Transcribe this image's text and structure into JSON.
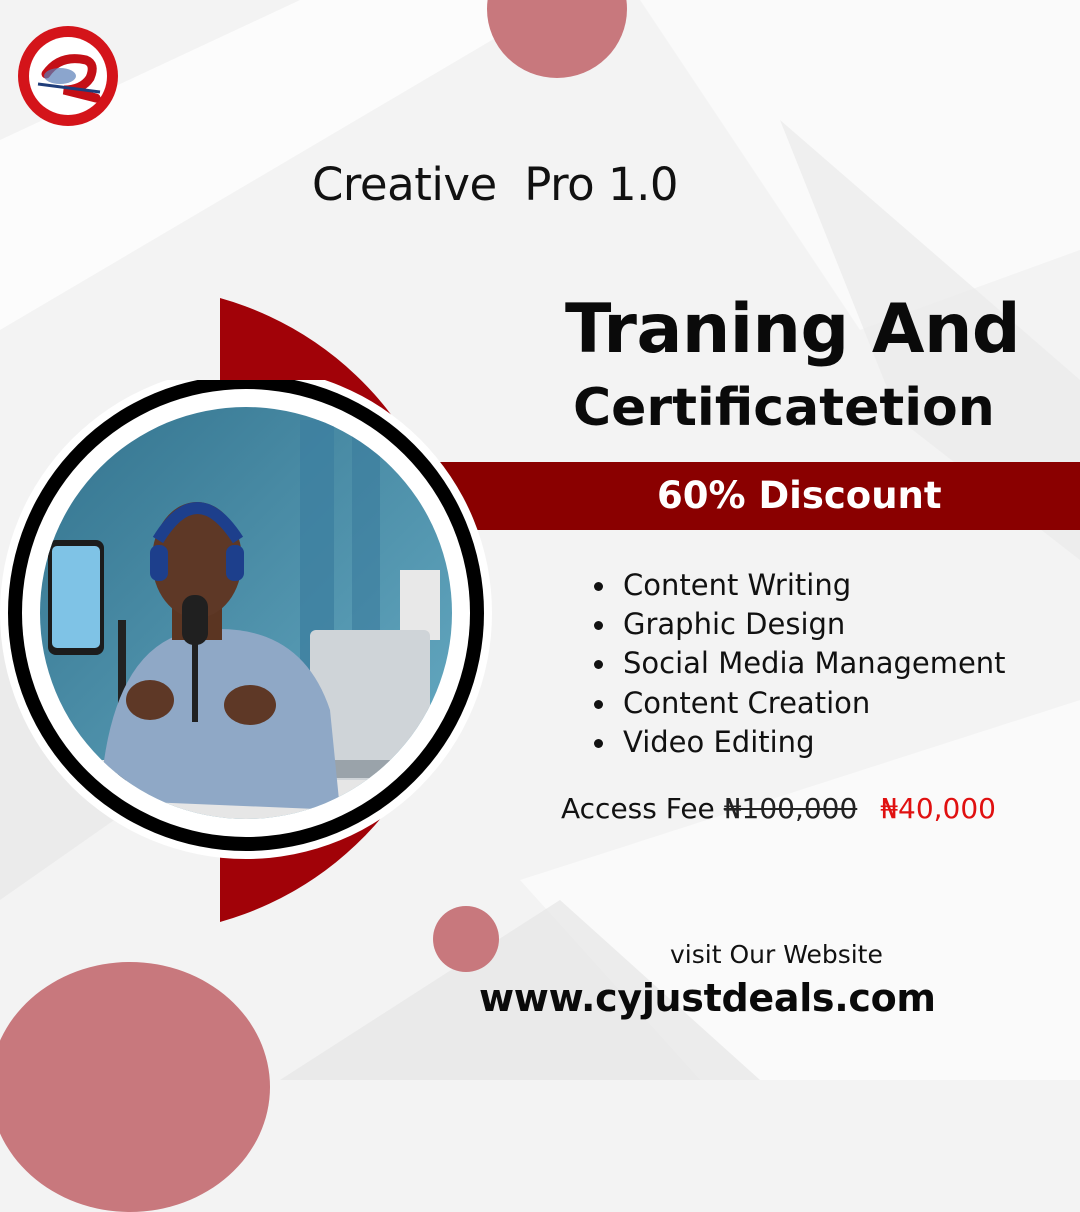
{
  "brand": {
    "logo_icon": "cyjust-logo-icon",
    "colors": {
      "primary_red": "#a10208",
      "dark_red": "#8a0000",
      "accent_pink": "#c8787d",
      "price_red": "#e01010"
    }
  },
  "title": "Creative  Pro 1.0",
  "headline": {
    "line1": "Traning And",
    "line2": "Certificatetion"
  },
  "discount_label": "60% Discount",
  "features": [
    "Content Writing",
    "Graphic Design",
    "Social Media Management",
    "Content Creation",
    "Video Editing"
  ],
  "access_fee": {
    "label": "Access Fee",
    "old_price": "₦100,000",
    "new_price": "₦40,000"
  },
  "website": {
    "prompt": "visit Our Website",
    "url": "www.cyjustdeals.com"
  },
  "photo": {
    "icon": "presenter-photo-icon"
  }
}
